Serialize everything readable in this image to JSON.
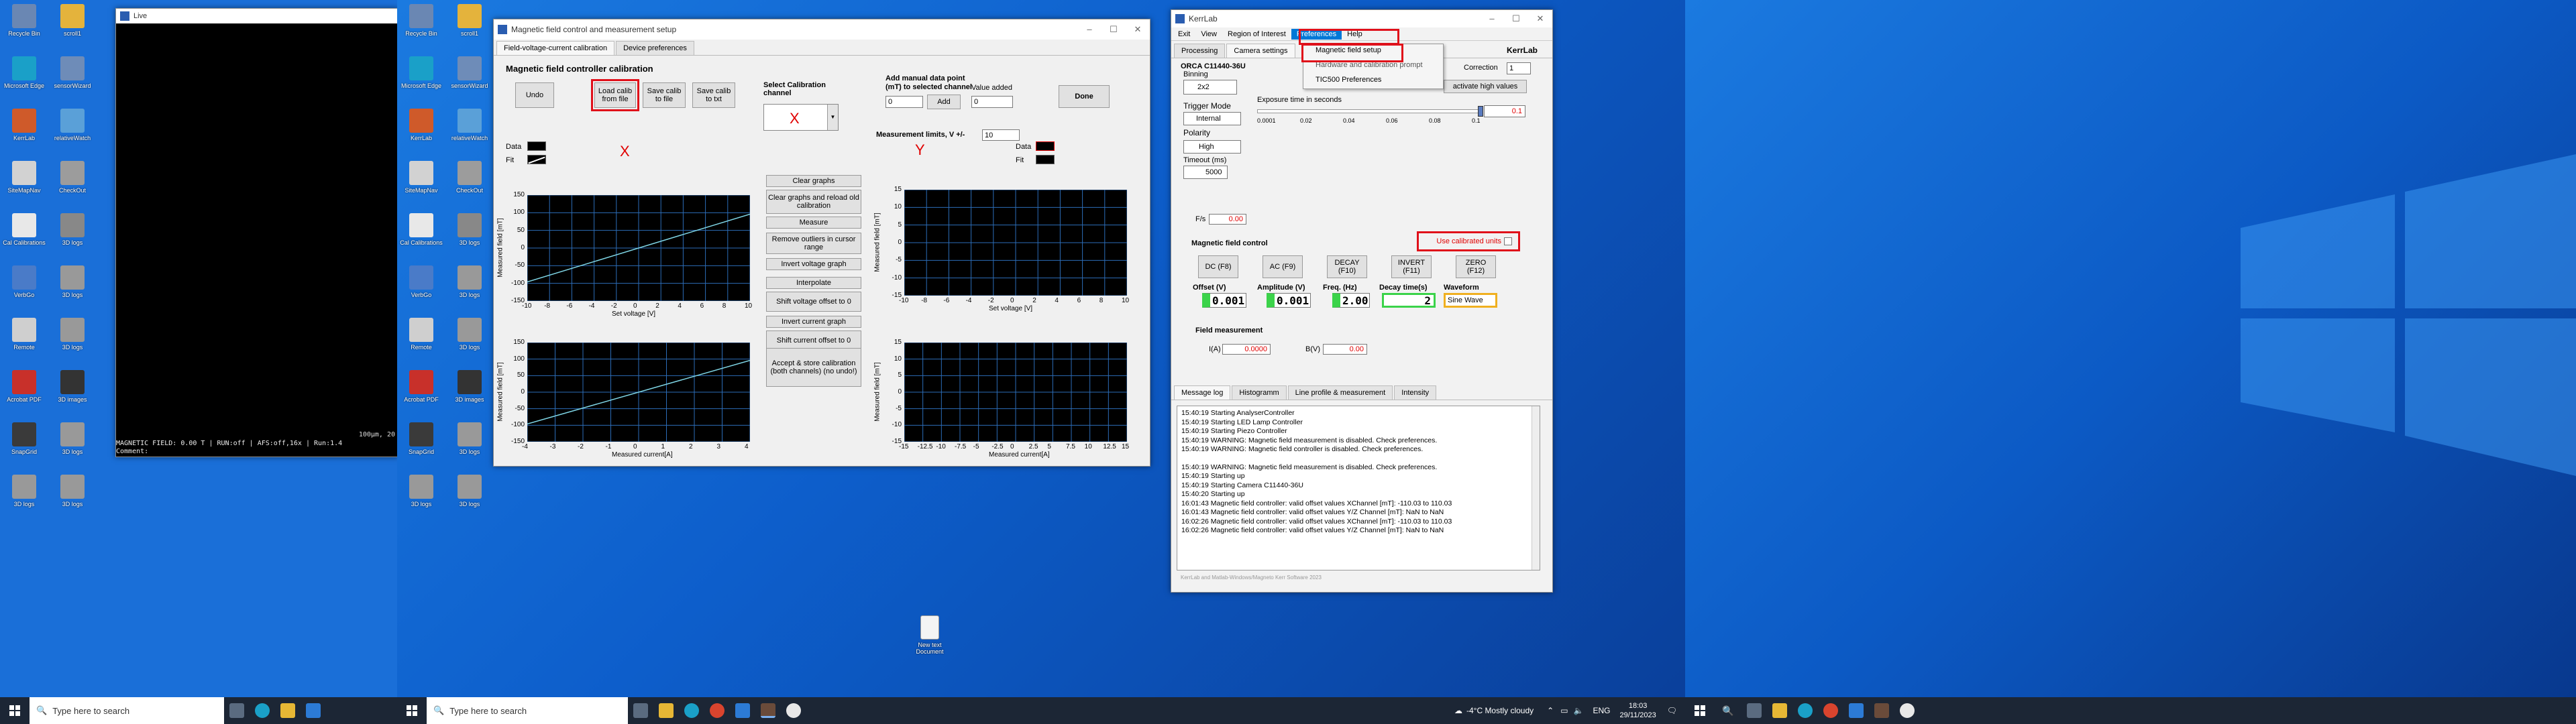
{
  "screen1": {
    "icons": [
      "Recycle Bin",
      "scroll1",
      "Microsoft Edge",
      "sensorWizard",
      "KerrLab",
      "relativeWatch",
      "SiteMapNav",
      "CheckOut",
      "Cal Calibrations",
      "3D logs",
      "VerbGo",
      "3D logs",
      "Remote",
      "3D logs",
      "Acrobat PDF",
      "3D images",
      "SnapGrid",
      "3D logs",
      "3D logs",
      "3D logs"
    ],
    "live": {
      "title": "Live",
      "status": "MAGNETIC FIELD:  0.00 T | RUN:off | AFS:off,16x | Run:1.4",
      "comment": "Comment:",
      "scale": "100µm, 20"
    }
  },
  "screen2": {
    "icons": [
      "Recycle Bin",
      "scroll1",
      "Microsoft Edge",
      "sensorWizard",
      "KerrLab",
      "relativeWatch",
      "SiteMapNav",
      "CheckOut",
      "Cal Calibrations",
      "3D logs",
      "VerbGo",
      "3D logs",
      "Remote",
      "3D logs",
      "Acrobat PDF",
      "3D images",
      "SnapGrid",
      "3D logs",
      "3D logs",
      "3D logs",
      "New text Document"
    ]
  },
  "calib": {
    "title": "Magnetic field control and measurement setup",
    "tabs": [
      "Field-voltage-current calibration",
      "Device preferences"
    ],
    "heading": "Magnetic field controller calibration",
    "undo": "Undo",
    "load": "Load calib from file",
    "save_file": "Save calib to file",
    "save_txt": "Save calib to txt",
    "select_channel": "Select Calibration channel",
    "add_manual": "Add manual data point (mT) to selected channel",
    "value_added": "Value added",
    "add": "Add",
    "manual_val1": "0",
    "manual_val2": "0",
    "done": "Done",
    "meas_limits": "Measurement limits, V +/-",
    "meas_limits_val": "10",
    "x_label": "X",
    "y_label": "Y",
    "data": "Data",
    "fit": "Fit",
    "middle_buttons": [
      "Clear graphs",
      "Clear graphs and reload old calibration",
      "Measure",
      "Remove outliers in cursor range",
      "Invert voltage graph",
      "Interpolate",
      "Shift voltage offset to 0",
      "Invert current graph",
      "Shift current offset to 0",
      "Accept & store calibration (both channels) (no undo!)"
    ],
    "ylabel": "Measured field [mT]",
    "xlabel_v": "Set voltage [V]",
    "xlabel_c": "Measured current[A]",
    "xv_ticks": [
      "-10",
      "-8",
      "-6",
      "-4",
      "-2",
      "0",
      "2",
      "4",
      "6",
      "8",
      "10"
    ],
    "xc_ticks": [
      "-4",
      "-3",
      "-2",
      "-1",
      "0",
      "1",
      "2",
      "3",
      "4"
    ],
    "yc_ticks": [
      "-15",
      "-12.5",
      "-10",
      "-7.5",
      "-5",
      "-2.5",
      "0",
      "2.5",
      "5",
      "7.5",
      "10",
      "12.5",
      "15"
    ],
    "y_ticks_x": [
      "150",
      "100",
      "50",
      "0",
      "-50",
      "-100",
      "-150"
    ],
    "y_ticks_y": [
      "15",
      "10",
      "5",
      "0",
      "-5",
      "-10",
      "-15"
    ]
  },
  "kerr": {
    "title": "KerrLab",
    "brand": "KerrLab",
    "menu": [
      "Exit",
      "View",
      "Region of Interest",
      "Preferences",
      "Help"
    ],
    "dropdown": [
      "Magnetic field setup",
      "Hardware and calibration prompt",
      "TIC500 Preferences"
    ],
    "tabs": [
      "Processing",
      "Camera settings"
    ],
    "camera": "ORCA C11440-36U",
    "binning": "Binning",
    "binning_val": "2x2",
    "correction": "Correction",
    "correction_val": "1",
    "activate": "activate high values",
    "exposure": "Exposure time in seconds",
    "exp_ticks": [
      "0.0001",
      "0.02",
      "0.04",
      "0.06",
      "0.08",
      "0.1"
    ],
    "exp_val": "0.1",
    "trigger": "Trigger Mode",
    "trigger_val": "Internal",
    "polarity": "Polarity",
    "polarity_val": "High",
    "timeout": "Timeout (ms)",
    "timeout_val": "5000",
    "fs": "F/s",
    "fs_val": "0.00",
    "use_cal": "Use calibrated units",
    "mfc": "Magnetic field control",
    "mfc_buttons": [
      "DC (F8)",
      "AC (F9)",
      "DECAY (F10)",
      "INVERT (F11)",
      "ZERO (F12)"
    ],
    "offset": "Offset (V)",
    "offset_val": "0.001",
    "amp": "Amplitude (V)",
    "amp_val": "0.001",
    "freq": "Freq. (Hz)",
    "freq_val": "2.00",
    "decay": "Decay time(s)",
    "decay_val": "2",
    "waveform": "Waveform",
    "waveform_val": "Sine Wave",
    "fm": "Field measurement",
    "ia": "I(A)",
    "ia_val": "0.0000",
    "bv": "B(V)",
    "bv_val": "0.00",
    "log_tabs": [
      "Message log",
      "Histogramm",
      "Line profile & measurement",
      "Intensity"
    ],
    "log": [
      "15:40:19 Starting AnalyserController",
      "15:40:19 Starting LED Lamp Controller",
      "15:40:19 Starting Piezo Controller",
      "15:40:19 WARNING: Magnetic field measurement is disabled. Check preferences.",
      "15:40:19 WARNING: Magnetic field controller is disabled. Check preferences.",
      "",
      "15:40:19 WARNING: Magnetic field measurement is disabled. Check preferences.",
      "15:40:19 Starting up",
      "15:40:19 Starting Camera C11440-36U",
      "15:40:20 Starting up",
      "16:01:43 Magnetic field controller: valid offset values XChannel [mT]: -110.03 to 110.03",
      "16:01:43 Magnetic field controller: valid offset values Y/Z Channel [mT]: NaN to NaN",
      "16:02:26 Magnetic field controller: valid offset values XChannel [mT]: -110.03 to 110.03",
      "16:02:26 Magnetic field controller: valid offset values Y/Z Channel [mT]: NaN to NaN"
    ],
    "footer": "KerrLab and Matlab-Windows/Magneto Kerr Software 2023"
  },
  "tb_left": {
    "search": "Type here to search"
  },
  "tb_mid": {
    "search": "Type here to search",
    "weather": "-4°C  Mostly cloudy",
    "lang": "ENG",
    "time": "18:03",
    "date": "29/11/2023"
  },
  "screen3": {
    "icon": "msgr"
  },
  "colors": {
    "accent": "#0078d7",
    "highlight": "#e0101a",
    "plot_line": "#7fd6e6"
  }
}
